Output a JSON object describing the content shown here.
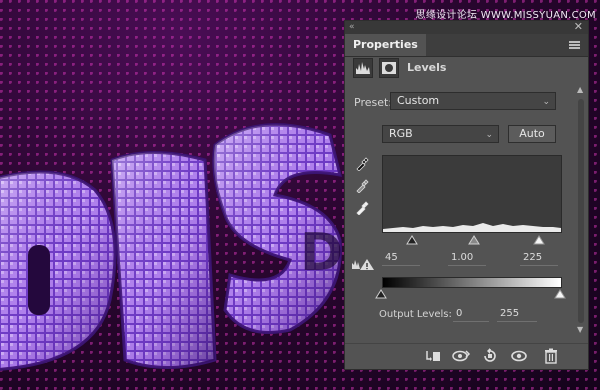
{
  "watermark": "思缘设计论坛  WWW.MISSYUAN.COM",
  "canvas_text": "DIS",
  "panel": {
    "tab_title": "Properties",
    "adjustment_title": "Levels",
    "preset_label": "Preset:",
    "preset_value": "Custom",
    "channel_value": "RGB",
    "auto_label": "Auto",
    "input_levels": {
      "black": "45",
      "gamma": "1.00",
      "white": "225"
    },
    "output_levels_label": "Output Levels:",
    "output_levels": {
      "black": "0",
      "white": "255"
    }
  },
  "colors": {
    "panel_bg": "#535353",
    "accent": "#ff2fd1"
  },
  "icons": [
    "histogram-icon",
    "mask-icon",
    "eyedropper-black-icon",
    "eyedropper-gray-icon",
    "eyedropper-white-icon",
    "warning-icon",
    "clip-to-layer-icon",
    "view-previous-state-icon",
    "reset-icon",
    "visibility-eye-icon",
    "trash-icon"
  ]
}
